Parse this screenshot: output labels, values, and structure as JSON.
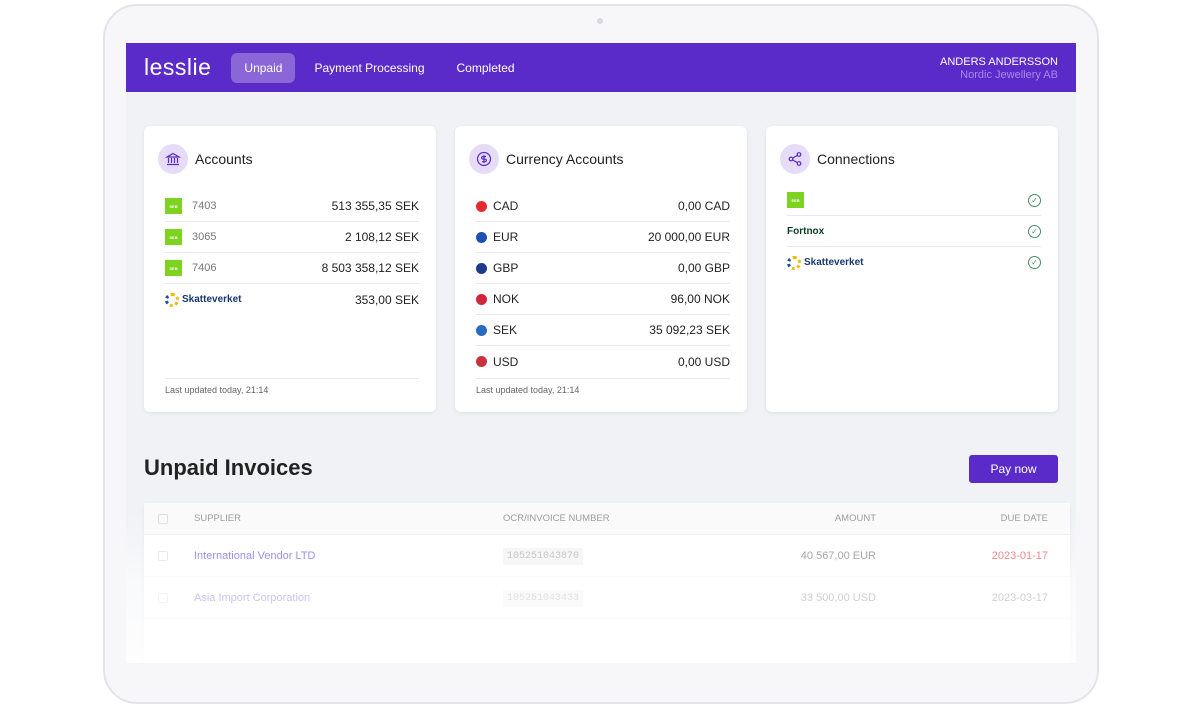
{
  "nav": {
    "logo": "lesslie",
    "tabs": [
      {
        "label": "Unpaid",
        "active": true
      },
      {
        "label": "Payment Processing"
      },
      {
        "label": "Completed"
      }
    ],
    "user_name": "ANDERS ANDERSSON",
    "company": "Nordic Jewellery AB"
  },
  "accounts": {
    "title": "Accounts",
    "icon": "bank-icon",
    "rows": [
      {
        "bank": "SEB",
        "number": "7403",
        "amount": "513 355,35 SEK"
      },
      {
        "bank": "SEB",
        "number": "3065",
        "amount": "2 108,12 SEK"
      },
      {
        "bank": "SEB",
        "number": "7406",
        "amount": "8 503 358,12 SEK"
      },
      {
        "bank": "Skatteverket",
        "number": "",
        "amount": "353,00 SEK"
      }
    ],
    "footer": "Last updated today, 21:14"
  },
  "currency": {
    "title": "Currency Accounts",
    "icon": "dollar-icon",
    "rows": [
      {
        "code": "CAD",
        "amount": "0,00 CAD",
        "flag": "#e52b2b"
      },
      {
        "code": "EUR",
        "amount": "20 000,00 EUR",
        "flag": "#1f4fb5"
      },
      {
        "code": "GBP",
        "amount": "0,00 GBP",
        "flag": "#1e3a8a"
      },
      {
        "code": "NOK",
        "amount": "96,00 NOK",
        "flag": "#d0283a"
      },
      {
        "code": "SEK",
        "amount": "35 092,23 SEK",
        "flag": "#2a6ac0"
      },
      {
        "code": "USD",
        "amount": "0,00 USD",
        "flag": "#c8313e"
      }
    ],
    "footer": "Last updated today, 21:14"
  },
  "connections": {
    "title": "Connections",
    "icon": "share-icon",
    "items": [
      {
        "name": "SEB",
        "connected": true
      },
      {
        "name": "Fortnox",
        "connected": true
      },
      {
        "name": "Skatteverket",
        "connected": true
      }
    ]
  },
  "invoices": {
    "title": "Unpaid Invoices",
    "pay_now": "Pay now",
    "columns": [
      "SUPPLIER",
      "OCR/INVOICE NUMBER",
      "AMOUNT",
      "DUE DATE"
    ],
    "rows": [
      {
        "supplier": "International Vendor LTD",
        "ocr": "105251043870",
        "amount": "40 567,00 EUR",
        "due": "2023-01-17",
        "overdue": true
      },
      {
        "supplier": "Asia Import Corporation",
        "ocr": "105251043433",
        "amount": "33 500,00 USD",
        "due": "2023-03-17",
        "overdue": false
      }
    ]
  },
  "colors": {
    "brand": "#5b2bc9",
    "seb": "#7ed321",
    "overdue": "#e5484d"
  }
}
